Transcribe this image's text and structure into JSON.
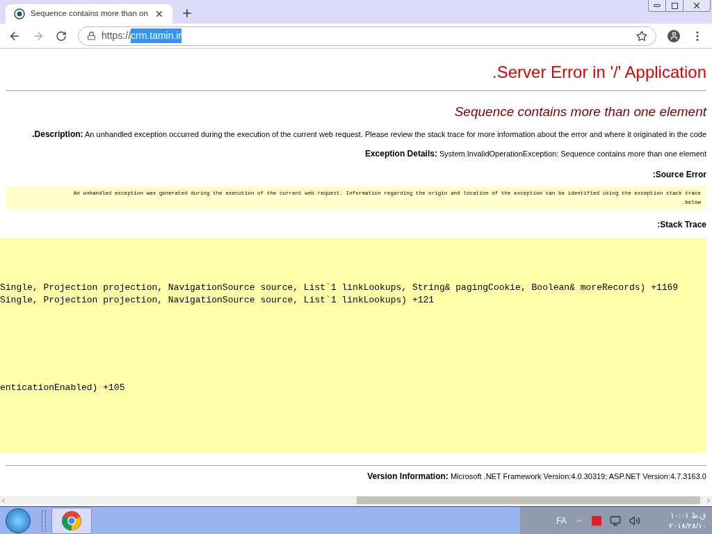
{
  "browser": {
    "tab": {
      "title": "Sequence contains more than on",
      "selected": true
    },
    "url": {
      "scheme": "https://",
      "host": "crm.tamin.ir"
    }
  },
  "page": {
    "title": ".Server Error in '/' Application",
    "error": "Sequence contains more than one element",
    "description": {
      "label": ".Description:",
      "text": "An unhandled exception occurred during the execution of the current web request. Please review the stack trace for more information about the error and where it originated in the code"
    },
    "exception": {
      "label": "Exception Details:",
      "text": "System.InvalidOperationException: Sequence contains more than one element"
    },
    "source_error": {
      "heading": ":Source Error",
      "lines": [
        "An unhandled exception was generated during the execution of the current web request. Information regarding the origin and location of the exception can be identified using the exception stack trace",
        ".below"
      ]
    },
    "stack_trace": {
      "heading": ":Stack Trace",
      "lines": [
        "Single, Projection projection, NavigationSource source, List`1 linkLookups, String& pagingCookie, Boolean& moreRecords) +1169",
        "Single, Projection projection, NavigationSource source, List`1 linkLookups) +121",
        "enticationEnabled) +105"
      ]
    },
    "version": {
      "label": "Version Information:",
      "text": "Microsoft .NET Framework Version:4.0.30319; ASP.NET Version:4.7.3163.0"
    }
  },
  "taskbar": {
    "language": "FA",
    "time": "ق.ظ ۱۰:۰۱",
    "date": "۲۰۱۸/۲۸/۱۰"
  }
}
